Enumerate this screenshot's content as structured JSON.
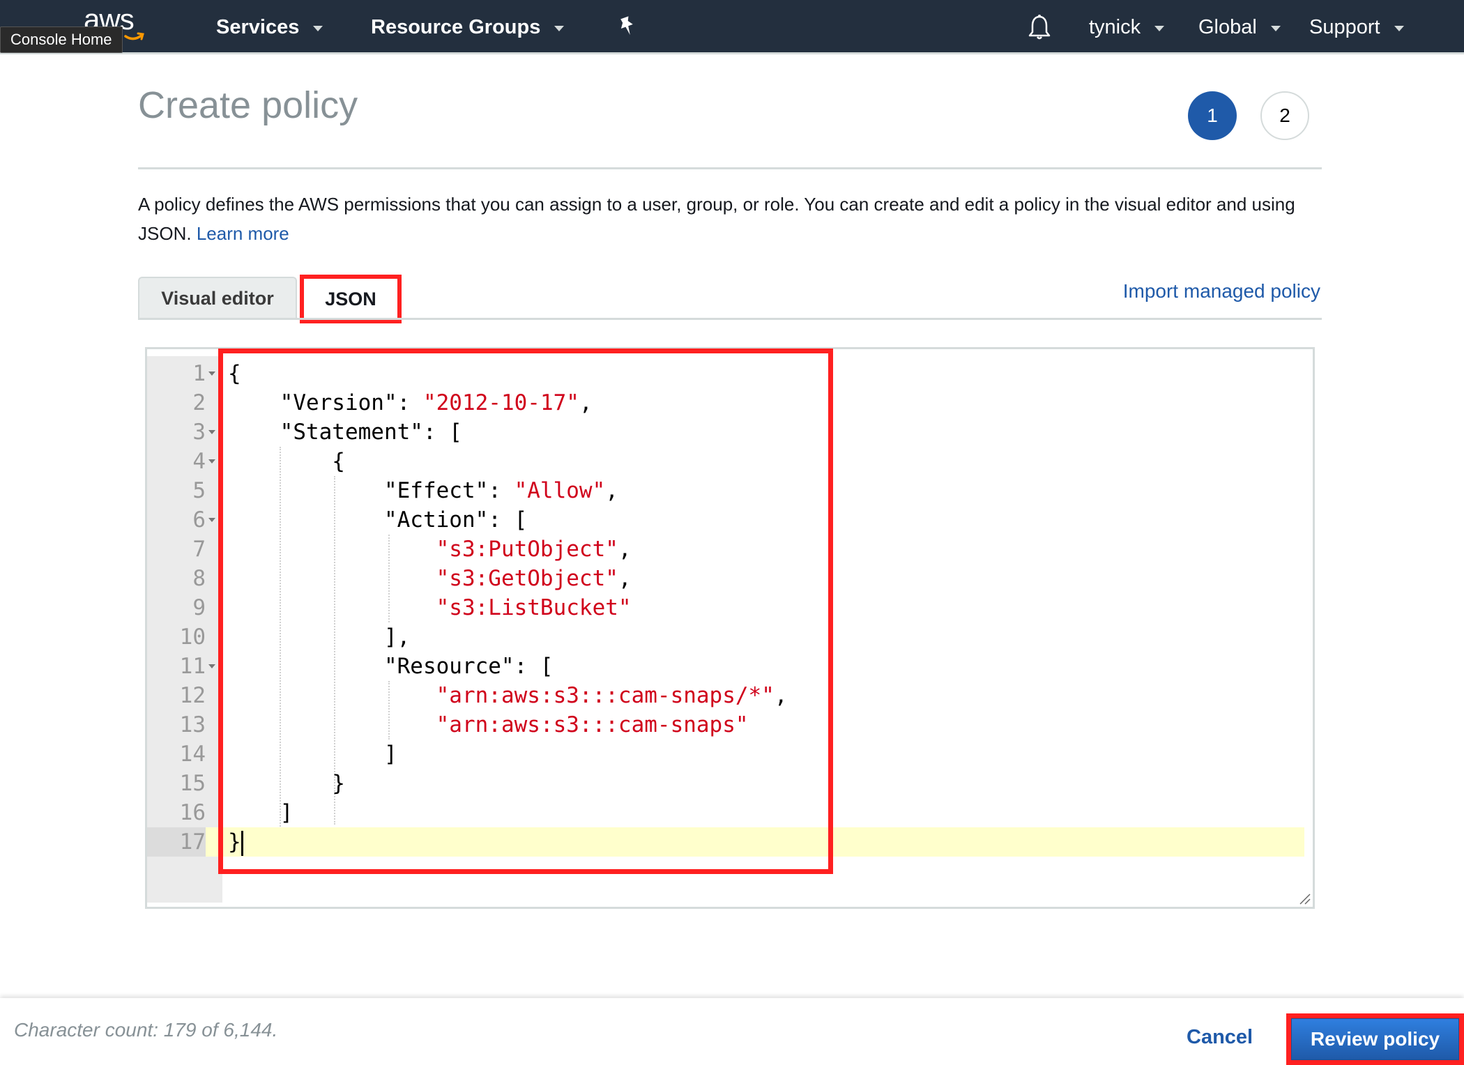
{
  "nav": {
    "logo_text": "aws",
    "tooltip": "Console Home",
    "services": "Services",
    "resource_groups": "Resource Groups",
    "account": "tynick",
    "region": "Global",
    "support": "Support"
  },
  "page": {
    "title": "Create policy",
    "steps": [
      "1",
      "2"
    ],
    "active_step": 1,
    "description": "A policy defines the AWS permissions that you can assign to a user, group, or role. You can create and edit a policy in the visual editor and using JSON.",
    "learn_more": "Learn more"
  },
  "tabs": {
    "visual_editor": "Visual editor",
    "json": "JSON",
    "active": "JSON",
    "import_link": "Import managed policy"
  },
  "editor": {
    "current_line": 17,
    "lines": [
      {
        "n": "1",
        "fold": true,
        "tokens": [
          [
            "p",
            "{"
          ]
        ]
      },
      {
        "n": "2",
        "fold": false,
        "tokens": [
          [
            "p",
            "    \"Version\": "
          ],
          [
            "s",
            "\"2012-10-17\""
          ],
          [
            "p",
            ","
          ]
        ]
      },
      {
        "n": "3",
        "fold": true,
        "tokens": [
          [
            "p",
            "    \"Statement\": ["
          ]
        ]
      },
      {
        "n": "4",
        "fold": true,
        "tokens": [
          [
            "p",
            "        {"
          ]
        ]
      },
      {
        "n": "5",
        "fold": false,
        "tokens": [
          [
            "p",
            "            \"Effect\": "
          ],
          [
            "s",
            "\"Allow\""
          ],
          [
            "p",
            ","
          ]
        ]
      },
      {
        "n": "6",
        "fold": true,
        "tokens": [
          [
            "p",
            "            \"Action\": ["
          ]
        ]
      },
      {
        "n": "7",
        "fold": false,
        "tokens": [
          [
            "p",
            "                "
          ],
          [
            "s",
            "\"s3:PutObject\""
          ],
          [
            "p",
            ","
          ]
        ]
      },
      {
        "n": "8",
        "fold": false,
        "tokens": [
          [
            "p",
            "                "
          ],
          [
            "s",
            "\"s3:GetObject\""
          ],
          [
            "p",
            ","
          ]
        ]
      },
      {
        "n": "9",
        "fold": false,
        "tokens": [
          [
            "p",
            "                "
          ],
          [
            "s",
            "\"s3:ListBucket\""
          ]
        ]
      },
      {
        "n": "10",
        "fold": false,
        "tokens": [
          [
            "p",
            "            ],"
          ]
        ]
      },
      {
        "n": "11",
        "fold": true,
        "tokens": [
          [
            "p",
            "            \"Resource\": ["
          ]
        ]
      },
      {
        "n": "12",
        "fold": false,
        "tokens": [
          [
            "p",
            "                "
          ],
          [
            "s",
            "\"arn:aws:s3:::cam-snaps/*\""
          ],
          [
            "p",
            ","
          ]
        ]
      },
      {
        "n": "13",
        "fold": false,
        "tokens": [
          [
            "p",
            "                "
          ],
          [
            "s",
            "\"arn:aws:s3:::cam-snaps\""
          ]
        ]
      },
      {
        "n": "14",
        "fold": false,
        "tokens": [
          [
            "p",
            "            ]"
          ]
        ]
      },
      {
        "n": "15",
        "fold": false,
        "tokens": [
          [
            "p",
            "        }"
          ]
        ]
      },
      {
        "n": "16",
        "fold": false,
        "tokens": [
          [
            "p",
            "    ]"
          ]
        ]
      },
      {
        "n": "17",
        "fold": false,
        "tokens": [
          [
            "p",
            "}"
          ]
        ]
      }
    ]
  },
  "footer": {
    "char_count": "Character count: 179 of 6,144.",
    "cancel": "Cancel",
    "review": "Review policy"
  },
  "colors": {
    "nav_bg": "#232f3e",
    "accent_blue": "#1f5aa9",
    "string_red": "#d0021b",
    "highlight_red": "#ff2020",
    "current_line": "#ffffcc"
  }
}
